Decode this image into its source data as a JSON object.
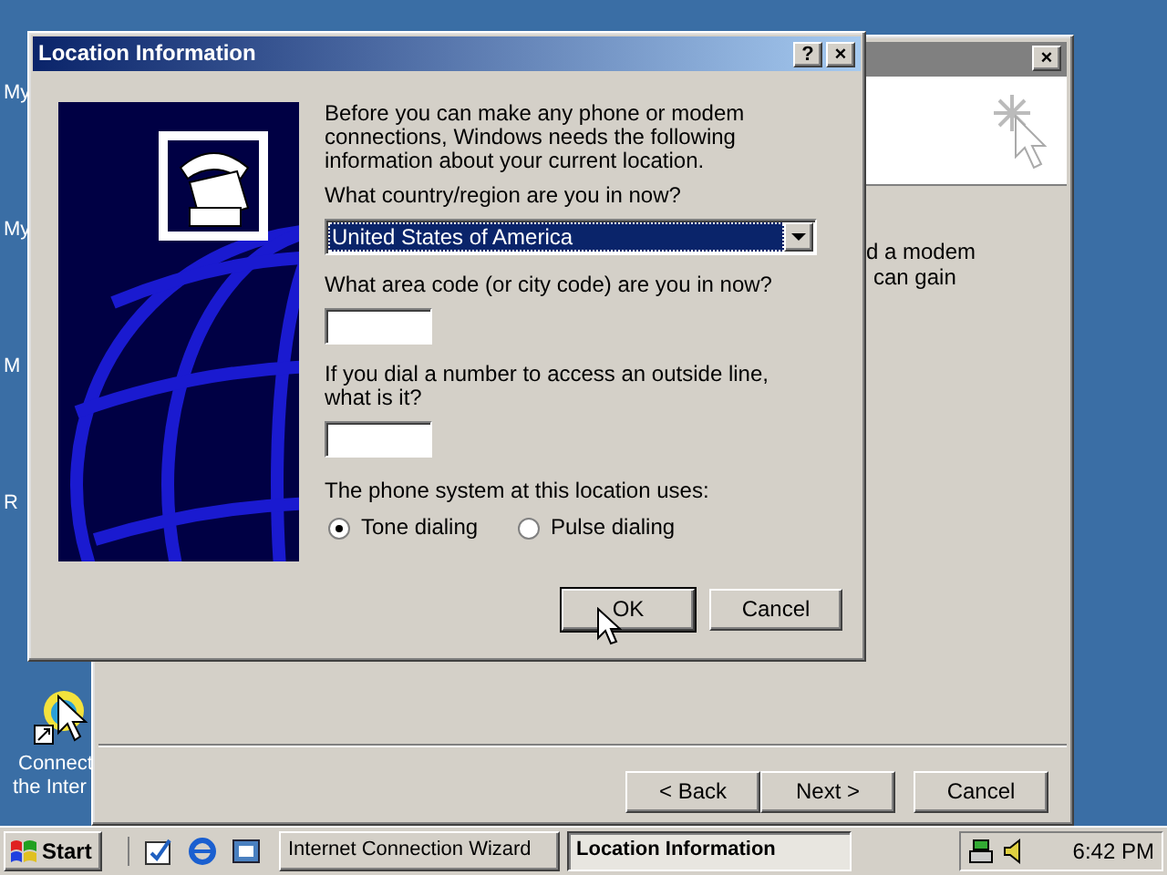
{
  "desktop_icons": [
    {
      "label": "My"
    },
    {
      "label": "My"
    },
    {
      "label": "M"
    },
    {
      "label": "R"
    }
  ],
  "desktop_shortcut": {
    "lines": [
      "Connect",
      "the Inter"
    ]
  },
  "wizard_window": {
    "close": "×",
    "body_lines": [
      "d a modem",
      "can gain"
    ],
    "buttons": [
      "< Back",
      "Next >",
      "Cancel"
    ]
  },
  "dialog": {
    "title": "Location Information",
    "title_buttons": [
      "?",
      "×"
    ],
    "intro": "Before you can make any phone or modem connections, Windows needs the following information about your current location.",
    "country_label": "What country/region are you in now?",
    "country_value": "United States of America",
    "area_code_label": "What area code (or city code) are you in now?",
    "outside_line_label": "If you dial a number to access an outside line, what is it?",
    "phone_system_label": "The phone system at this location uses:",
    "dialing_options": [
      {
        "label": "Tone dialing",
        "selected": true
      },
      {
        "label": "Pulse dialing",
        "selected": false
      }
    ],
    "buttons": [
      {
        "label": "OK",
        "default": true
      },
      {
        "label": "Cancel",
        "default": false
      }
    ]
  },
  "taskbar": {
    "start": "Start",
    "tasks": [
      {
        "label": "Internet Connection Wizard",
        "selected": false
      },
      {
        "label": "Location Information",
        "selected": true
      }
    ],
    "clock": "6:42 PM"
  }
}
